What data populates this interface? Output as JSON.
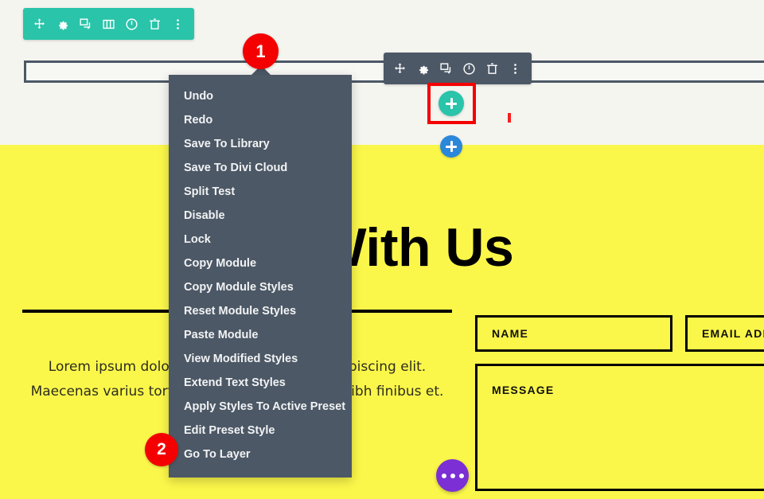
{
  "page": {
    "hero_heading": "rk With Us",
    "hero_body": "Lorem ipsum dolor sit amet, consectetur adipiscing elit. Maecenas varius tortor nibh, sit amet tempor nibh finibus et."
  },
  "form": {
    "name_label": "NAME",
    "email_label": "EMAIL ADD",
    "message_label": "MESSAGE"
  },
  "section_toolbar": {
    "items": [
      {
        "icon": "move-icon",
        "title": "Move Section"
      },
      {
        "icon": "gear-icon",
        "title": "Section Settings"
      },
      {
        "icon": "duplicate-icon",
        "title": "Duplicate Section"
      },
      {
        "icon": "columns-icon",
        "title": "Choose Column Layout"
      },
      {
        "icon": "power-icon",
        "title": "Disable Section"
      },
      {
        "icon": "trash-icon",
        "title": "Delete Section"
      },
      {
        "icon": "more-dots-icon",
        "title": "Other Options"
      }
    ]
  },
  "module_toolbar": {
    "items": [
      {
        "icon": "move-icon",
        "title": "Move Module"
      },
      {
        "icon": "gear-icon",
        "title": "Module Settings"
      },
      {
        "icon": "duplicate-icon",
        "title": "Duplicate Module"
      },
      {
        "icon": "power-icon",
        "title": "Disable Module"
      },
      {
        "icon": "trash-icon",
        "title": "Delete Module"
      },
      {
        "icon": "more-dots-icon",
        "title": "Other Options"
      }
    ]
  },
  "context_menu": {
    "items": [
      "Undo",
      "Redo",
      "Save To Library",
      "Save To Divi Cloud",
      "Split Test",
      "Disable",
      "Lock",
      "Copy Module",
      "Copy Module Styles",
      "Reset Module Styles",
      "Paste Module",
      "View Modified Styles",
      "Extend Text Styles",
      "Apply Styles To Active Preset",
      "Edit Preset Style",
      "Go To Layer"
    ]
  },
  "annotations": {
    "badge_1": "1",
    "badge_2": "2"
  },
  "buttons": {
    "add_module_icon": "plus-icon",
    "add_row_icon": "plus-icon",
    "page_settings_icon": "ellipsis-icon"
  },
  "colors": {
    "teal": "#29c4a9",
    "slate": "#4c5866",
    "yellow": "#fbf74a",
    "blue": "#2b87da",
    "purple": "#7b2fd4",
    "red": "#f40000"
  }
}
